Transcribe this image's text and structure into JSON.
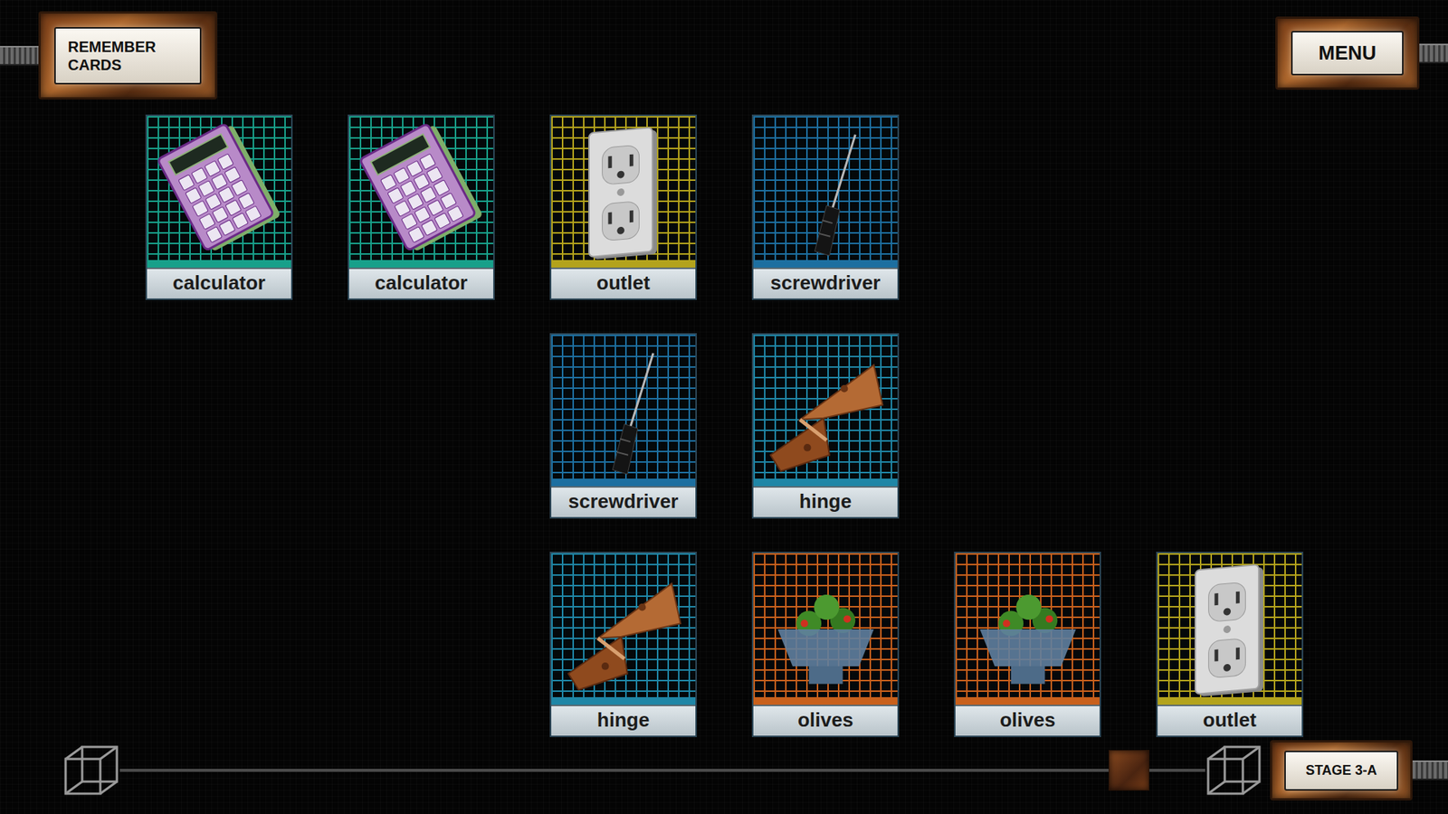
{
  "header": {
    "remember_button": "REMEMBER CARDS",
    "menu_button": "MENU"
  },
  "board": {
    "rows": [
      [
        {
          "kind": "calculator",
          "label": "calculator",
          "color": "#18a08a"
        },
        {
          "kind": "calculator",
          "label": "calculator",
          "color": "#18a08a"
        },
        {
          "kind": "outlet",
          "label": "outlet",
          "color": "#b3a31c"
        },
        {
          "kind": "screwdriver",
          "label": "screwdriver",
          "color": "#1d6fa0"
        },
        {
          "kind": "empty"
        },
        {
          "kind": "empty"
        }
      ],
      [
        {
          "kind": "empty"
        },
        {
          "kind": "empty"
        },
        {
          "kind": "screwdriver",
          "label": "screwdriver",
          "color": "#1d6fa0"
        },
        {
          "kind": "hinge",
          "label": "hinge",
          "color": "#1f86a6"
        },
        {
          "kind": "empty"
        },
        {
          "kind": "empty"
        }
      ],
      [
        {
          "kind": "empty"
        },
        {
          "kind": "empty"
        },
        {
          "kind": "hinge",
          "label": "hinge",
          "color": "#1f86a6"
        },
        {
          "kind": "olives",
          "label": "olives",
          "color": "#c8601c"
        },
        {
          "kind": "olives",
          "label": "olives",
          "color": "#c8601c"
        },
        {
          "kind": "outlet",
          "label": "outlet",
          "color": "#b3a31c"
        }
      ]
    ]
  },
  "progress": {
    "level": 0.93
  },
  "stage": "STAGE 3-A"
}
